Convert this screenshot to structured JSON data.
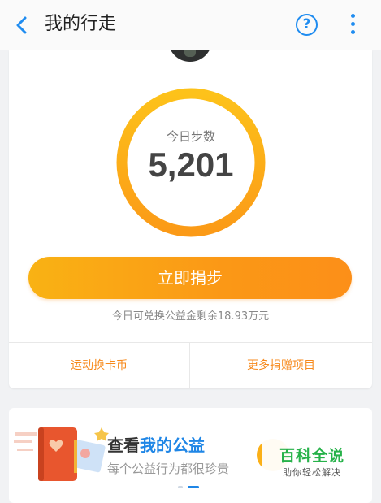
{
  "header": {
    "title": "我的行走",
    "help_label": "?",
    "back_icon": "chevron-left-icon",
    "more_icon": "more-vertical-icon",
    "accent_color": "#1f8cf0"
  },
  "steps": {
    "label": "今日步数",
    "value": "5,201",
    "ring_colors": [
      "#fdc21a",
      "#fb9a17"
    ]
  },
  "donate": {
    "button_label": "立即捐步",
    "remaining_text": "今日可兑换公益金剩余18.93万元"
  },
  "links": {
    "left_label": "运动换卡币",
    "right_label": "更多捐赠项目",
    "color": "#f78a1c"
  },
  "banner": {
    "title_prefix": "查看",
    "title_highlight": "我的公益",
    "subtitle": "每个公益行为都很珍贵",
    "carousel_index": 2,
    "carousel_total": 2
  },
  "watermark": {
    "main": "百科全说",
    "sub": "助你轻松解决"
  }
}
